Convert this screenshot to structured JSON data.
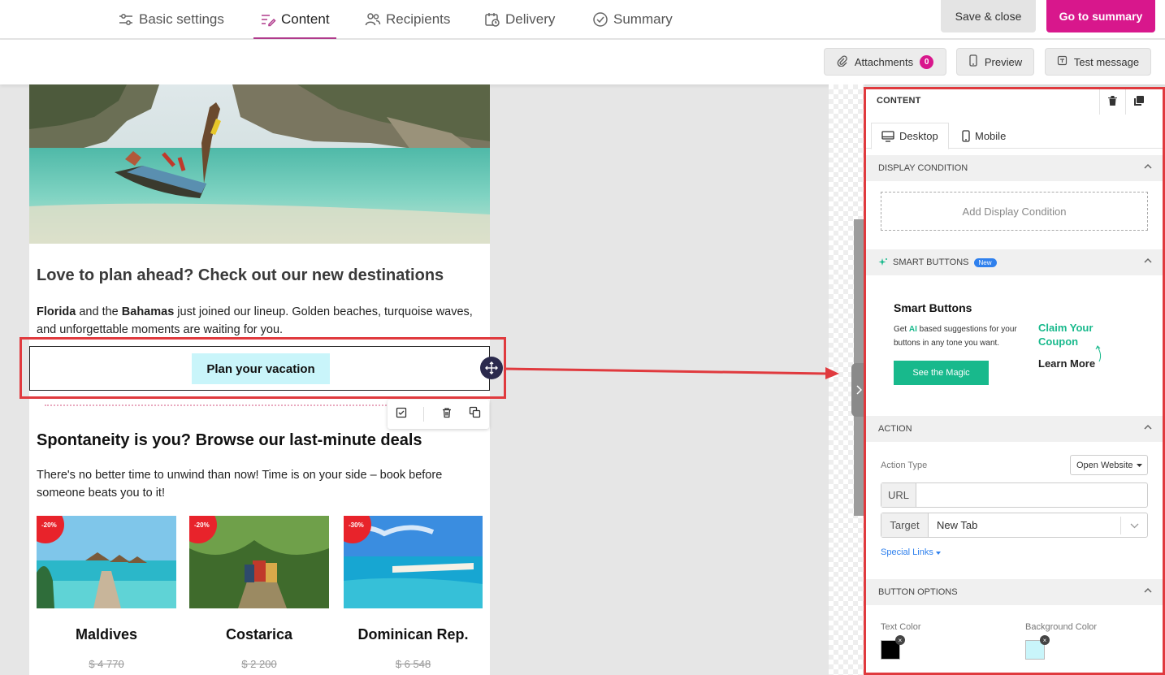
{
  "steps": {
    "basic": "Basic settings",
    "content": "Content",
    "recipients": "Recipients",
    "delivery": "Delivery",
    "summary": "Summary"
  },
  "header": {
    "save_close": "Save & close",
    "go_summary": "Go to summary"
  },
  "toolbar": {
    "attachments": "Attachments",
    "attachments_count": "0",
    "preview": "Preview",
    "test_message": "Test message"
  },
  "email": {
    "heading1": "Love to plan ahead? Check out our new destinations",
    "para1_bold1": "Florida",
    "para1_mid": " and the ",
    "para1_bold2": "Bahamas",
    "para1_rest": " just joined our lineup. Golden beaches, turquoise waves, and unforgettable moments are waiting for you.",
    "cta": "Plan your vacation",
    "heading2": "Spontaneity is you? Browse our last-minute deals",
    "para2": "There's no better time to unwind than now! Time is on your side – book before someone beats you to it!",
    "cards": [
      {
        "discount": "-20%",
        "name": "Maldives",
        "price": "$ 4 770"
      },
      {
        "discount": "-20%",
        "name": "Costarica",
        "price": "$ 2 200"
      },
      {
        "discount": "-30%",
        "name": "Dominican Rep.",
        "price": "$ 6 548"
      }
    ]
  },
  "panel": {
    "title": "CONTENT",
    "tab_desktop": "Desktop",
    "tab_mobile": "Mobile",
    "display_condition": "DISPLAY CONDITION",
    "add_condition": "Add Display Condition",
    "smart_buttons": "SMART BUTTONS",
    "new_badge": "New",
    "sb_title": "Smart Buttons",
    "sb_desc_pre": "Get ",
    "sb_desc_ai": "AI",
    "sb_desc_post": " based suggestions for your buttons in any tone you want.",
    "sb_button": "See the Magic",
    "sb_claim": "Claim Your Coupon",
    "sb_learn": "Learn More",
    "action": "ACTION",
    "action_type_label": "Action Type",
    "action_type_value": "Open Website",
    "url_label": "URL",
    "url_value": "",
    "target_label": "Target",
    "target_value": "New Tab",
    "special_links": "Special Links",
    "button_options": "BUTTON OPTIONS",
    "text_color_label": "Text Color",
    "bg_color_label": "Background Color",
    "text_color": "#000000",
    "bg_color": "#c9f5fa"
  },
  "colors": {
    "brand": "#d8178c",
    "accent_green": "#18b98c",
    "annotation_red": "#e03a3e"
  }
}
